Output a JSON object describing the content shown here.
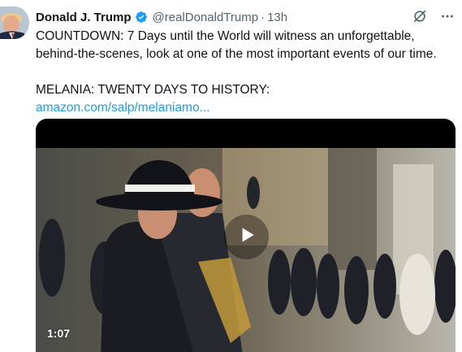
{
  "tweet": {
    "author_name": "Donald J. Trump",
    "handle": "@realDonaldTrump",
    "separator": "·",
    "time": "13h",
    "line1": "COUNTDOWN: 7 Days until the World will witness an unforgettable,",
    "line2": "behind-the-scenes, look at one of the most important events of our time.",
    "line3": "MELANIA: TWENTY DAYS TO HISTORY:",
    "link": "amazon.com/salp/melaniamo...",
    "video_duration": "1:07"
  },
  "icons": {
    "verified": "verified-badge-icon",
    "grok": "grok-icon",
    "more": "more-options-icon",
    "play": "play-icon"
  },
  "colors": {
    "verified": "#1d9bf0",
    "link": "#1d9bf0",
    "secondary_text": "#536471"
  }
}
